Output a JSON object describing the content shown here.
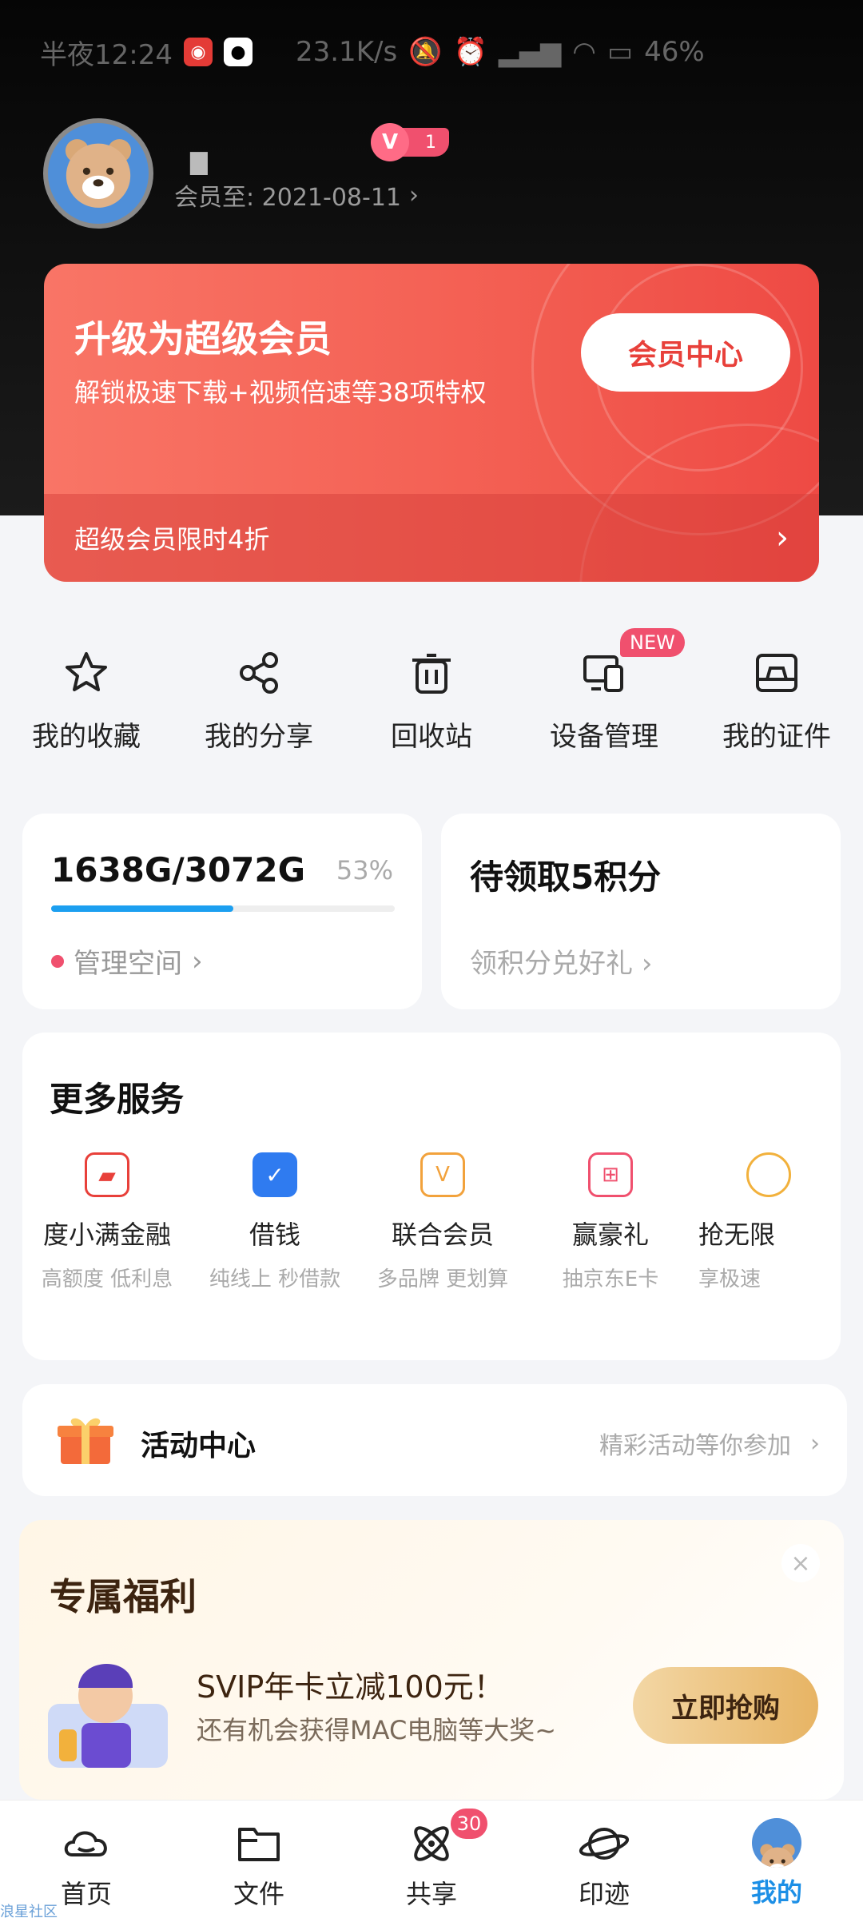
{
  "status_bar": {
    "time": "半夜12:24",
    "net_speed": "23.1K/s",
    "battery": "46%"
  },
  "profile": {
    "member_until": "会员至: 2021-08-11",
    "vip_level": "1"
  },
  "vip_card": {
    "title": "升级为超级会员",
    "subtitle": "解锁极速下载+视频倍速等38项特权",
    "button": "会员中心",
    "promo": "超级会员限时4折"
  },
  "quick_actions": [
    {
      "label": "我的收藏",
      "icon": "star-icon"
    },
    {
      "label": "我的分享",
      "icon": "share-icon"
    },
    {
      "label": "回收站",
      "icon": "trash-icon"
    },
    {
      "label": "设备管理",
      "icon": "devices-icon",
      "badge": "NEW"
    },
    {
      "label": "我的证件",
      "icon": "id-card-icon"
    }
  ],
  "storage": {
    "used_total": "1638G/3072G",
    "percent_label": "53%",
    "percent": 0.53,
    "manage": "管理空间"
  },
  "points": {
    "title": "待领取5积分",
    "subtitle": "领积分兑好礼"
  },
  "services": {
    "title": "更多服务",
    "items": [
      {
        "name": "度小满金融",
        "desc": "高额度 低利息",
        "icon": "wallet-icon",
        "color": "#e8403a"
      },
      {
        "name": "借钱",
        "desc": "纯线上  秒借款",
        "icon": "loan-icon",
        "color": "#2f7bf0"
      },
      {
        "name": "联合会员",
        "desc": "多品牌 更划算",
        "icon": "vip-card-icon",
        "color": "#f2a23c"
      },
      {
        "name": "赢豪礼",
        "desc": "抽京东E卡",
        "icon": "gift-icon",
        "color": "#f0506e"
      },
      {
        "name": "抢无限",
        "desc": "享极速",
        "icon": "coin-icon",
        "color": "#f2b13c"
      }
    ]
  },
  "activity": {
    "title": "活动中心",
    "subtitle": "精彩活动等你参加"
  },
  "welfare": {
    "title": "专属福利",
    "line1": "SVIP年卡立减100元！",
    "line2": "还有机会获得MAC电脑等大奖~",
    "button": "立即抢购"
  },
  "tabbar": [
    {
      "label": "首页",
      "icon": "cloud-icon"
    },
    {
      "label": "文件",
      "icon": "folder-icon"
    },
    {
      "label": "共享",
      "icon": "atom-icon",
      "badge": "30"
    },
    {
      "label": "印迹",
      "icon": "planet-icon"
    },
    {
      "label": "我的",
      "icon": "avatar-icon",
      "active": true
    }
  ],
  "footer_watermark": "浪星社区"
}
